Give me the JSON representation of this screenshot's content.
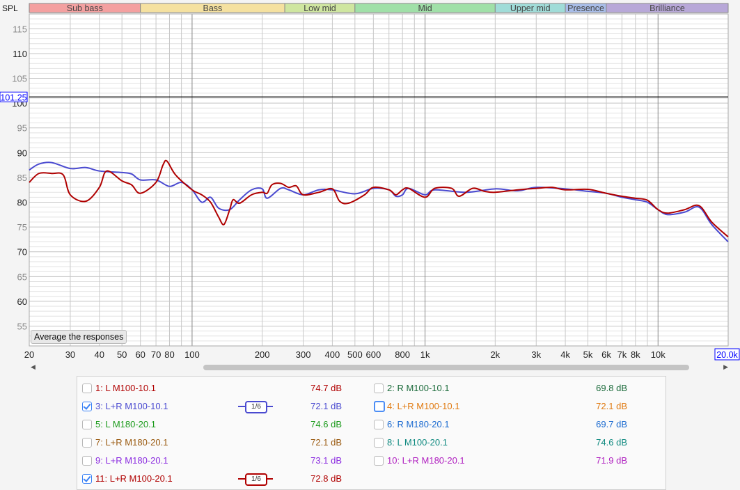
{
  "chart_data": {
    "type": "line",
    "ylabel": "SPL",
    "xscale": "log",
    "xlim": [
      20,
      20000
    ],
    "ylim": [
      51,
      118
    ],
    "grid": true,
    "y_ticks": [
      55,
      60,
      65,
      70,
      75,
      80,
      85,
      90,
      95,
      100,
      105,
      110,
      115
    ],
    "x_ticks": [
      {
        "v": 20,
        "t": "20"
      },
      {
        "v": 30,
        "t": "30"
      },
      {
        "v": 40,
        "t": "40"
      },
      {
        "v": 50,
        "t": "50"
      },
      {
        "v": 60,
        "t": "60"
      },
      {
        "v": 70,
        "t": "70"
      },
      {
        "v": 80,
        "t": "80"
      },
      {
        "v": 100,
        "t": "100"
      },
      {
        "v": 200,
        "t": "200"
      },
      {
        "v": 300,
        "t": "300"
      },
      {
        "v": 400,
        "t": "400"
      },
      {
        "v": 500,
        "t": "500"
      },
      {
        "v": 600,
        "t": "600"
      },
      {
        "v": 800,
        "t": "800"
      },
      {
        "v": 1000,
        "t": "1k"
      },
      {
        "v": 2000,
        "t": "2k"
      },
      {
        "v": 3000,
        "t": "3k"
      },
      {
        "v": 4000,
        "t": "4k"
      },
      {
        "v": 5000,
        "t": "5k"
      },
      {
        "v": 6000,
        "t": "6k"
      },
      {
        "v": 7000,
        "t": "7k"
      },
      {
        "v": 8000,
        "t": "8k"
      },
      {
        "v": 10000,
        "t": "10k"
      }
    ],
    "cursor": {
      "y_label": "101.25",
      "y": 101.25,
      "x_label": "20.0k"
    },
    "bands": [
      {
        "name": "Sub bass",
        "from": 20,
        "to": 60,
        "color": "#f4a0a0"
      },
      {
        "name": "Bass",
        "from": 60,
        "to": 250,
        "color": "#f5e1a0"
      },
      {
        "name": "Low mid",
        "from": 250,
        "to": 500,
        "color": "#cfe6a0"
      },
      {
        "name": "Mid",
        "from": 500,
        "to": 2000,
        "color": "#a0e0a8"
      },
      {
        "name": "Upper mid",
        "from": 2000,
        "to": 4000,
        "color": "#a0dcd8"
      },
      {
        "name": "Presence",
        "from": 4000,
        "to": 6000,
        "color": "#a8bde8"
      },
      {
        "name": "Brilliance",
        "from": 6000,
        "to": 20000,
        "color": "#b8a8d8"
      }
    ],
    "series": [
      {
        "name": "3: L+R M100-10.1",
        "color": "#4a4ad0",
        "x": [
          20,
          22,
          25,
          30,
          35,
          40,
          50,
          55,
          60,
          70,
          80,
          90,
          100,
          110,
          120,
          130,
          145,
          160,
          180,
          200,
          210,
          240,
          260,
          300,
          350,
          400,
          500,
          600,
          700,
          750,
          800,
          850,
          1000,
          1100,
          1500,
          2000,
          2500,
          3000,
          4000,
          5000,
          6000,
          7000,
          8000,
          9000,
          10000,
          11000,
          13000,
          15000,
          17000,
          20000
        ],
        "y": [
          86.5,
          87.7,
          88,
          86.8,
          87,
          86.3,
          86,
          85.7,
          84.5,
          84.5,
          83.2,
          84,
          82.5,
          80,
          81,
          78.8,
          78.5,
          80.5,
          82.5,
          82.7,
          80.8,
          82.8,
          82.5,
          81.5,
          82.5,
          82.5,
          81.7,
          82.8,
          82.5,
          81.2,
          81.5,
          82.8,
          81.5,
          82.5,
          82,
          82.7,
          82.3,
          83,
          82.7,
          82.2,
          81.8,
          81,
          80.5,
          80,
          78.5,
          77.5,
          78,
          79,
          75.5,
          72
        ]
      },
      {
        "name": "11: L+R M100-20.1",
        "color": "#b00000",
        "x": [
          20,
          22,
          25,
          28,
          30,
          35,
          40,
          43,
          50,
          55,
          60,
          70,
          75,
          78,
          85,
          100,
          110,
          120,
          130,
          137,
          145,
          150,
          160,
          180,
          200,
          210,
          220,
          240,
          260,
          280,
          300,
          350,
          400,
          430,
          470,
          550,
          600,
          700,
          750,
          800,
          850,
          1000,
          1100,
          1300,
          1400,
          1600,
          1800,
          2000,
          2500,
          3000,
          3500,
          4000,
          5000,
          6000,
          7000,
          8000,
          9000,
          10000,
          11000,
          13000,
          15000,
          17000,
          20000
        ],
        "y": [
          84,
          85.8,
          85.8,
          85.5,
          81.5,
          80.2,
          83,
          86.3,
          84.3,
          83.5,
          81.8,
          84,
          87.5,
          88.3,
          85.5,
          82.5,
          81.5,
          80,
          77,
          75.5,
          78.5,
          80.5,
          79.8,
          81.5,
          82,
          81.8,
          83.5,
          83.8,
          83,
          83.3,
          81.5,
          82,
          82.7,
          80.2,
          79.8,
          81.5,
          83,
          82.5,
          81.5,
          82.5,
          82.8,
          81,
          82.8,
          82.8,
          81.2,
          82.8,
          82.2,
          82,
          82.5,
          82.8,
          83,
          82.5,
          82.6,
          81.8,
          81.2,
          80.8,
          80.4,
          78.5,
          77.8,
          78.5,
          79.3,
          76,
          73
        ]
      }
    ]
  },
  "controls": {
    "average_button": "Average the responses"
  },
  "legend": {
    "left": [
      {
        "label": "1: L M100-10.1",
        "value": "74.7 dB",
        "color": "#b00000",
        "checked": false
      },
      {
        "label": "3: L+R M100-10.1",
        "value": "72.1 dB",
        "color": "#4a4ad0",
        "checked": true,
        "smoothing": "1/6"
      },
      {
        "label": "5: L M180-20.1",
        "value": "74.6 dB",
        "color": "#1a9a1a",
        "checked": false
      },
      {
        "label": "7: L+R M180-20.1",
        "value": "72.1 dB",
        "color": "#9a5a10",
        "checked": false
      },
      {
        "label": "9: L+R M180-20.1",
        "value": "73.1 dB",
        "color": "#8a2ae0",
        "checked": false
      },
      {
        "label": "11: L+R M100-20.1",
        "value": "72.8 dB",
        "color": "#b00000",
        "checked": true,
        "smoothing": "1/6"
      }
    ],
    "right": [
      {
        "label": "2: R M100-10.1",
        "value": "69.8 dB",
        "color": "#1a6a3a",
        "checked": false
      },
      {
        "label": "4: L+R M100-10.1",
        "value": "72.1 dB",
        "color": "#e07a10",
        "checked": false,
        "focused": true
      },
      {
        "label": "6: R M180-20.1",
        "value": "69.7 dB",
        "color": "#1a6ad0",
        "checked": false
      },
      {
        "label": "8: L M100-20.1",
        "value": "74.6 dB",
        "color": "#108a80",
        "checked": false
      },
      {
        "label": "10: L+R M180-20.1",
        "value": "71.9 dB",
        "color": "#b020c0",
        "checked": false
      }
    ]
  }
}
